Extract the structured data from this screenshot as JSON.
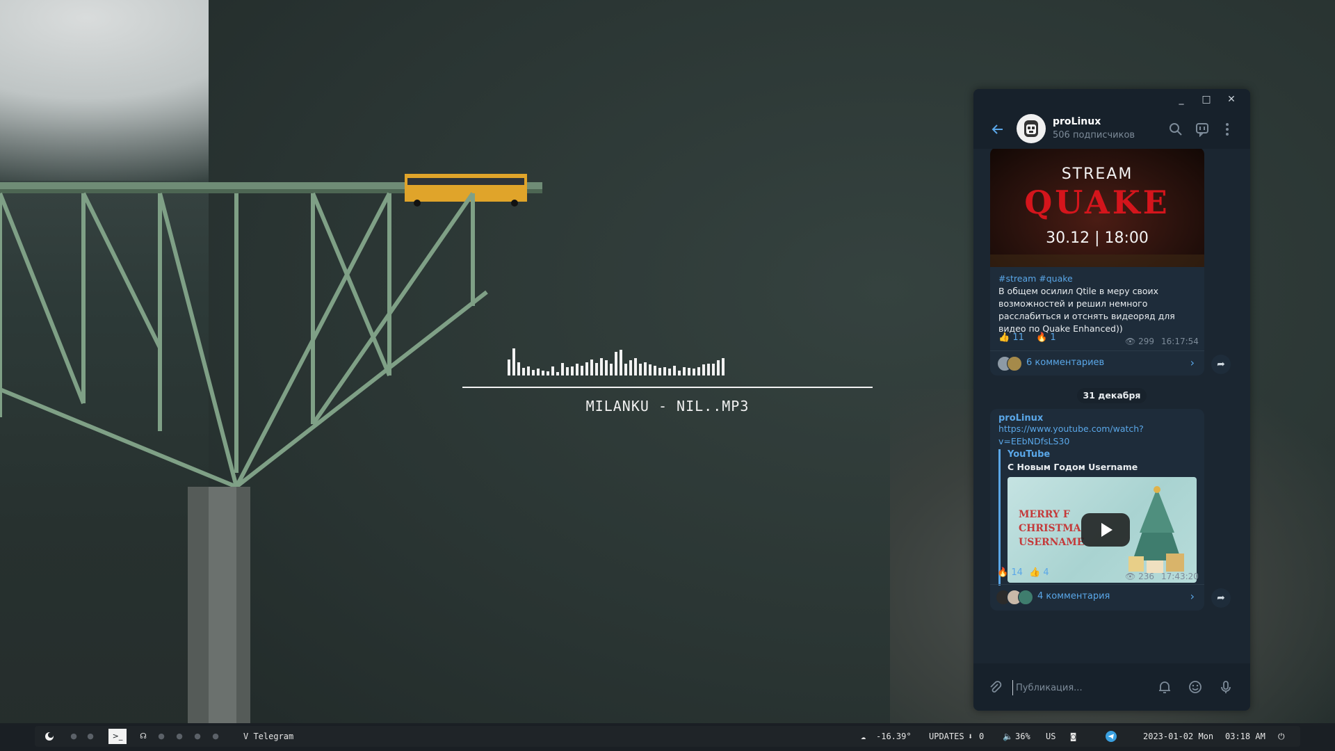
{
  "visualizer": {
    "track": "MILANKU - NIL..MP3",
    "levels": [
      0.38,
      0.65,
      0.32,
      0.18,
      0.22,
      0.14,
      0.16,
      0.12,
      0.1,
      0.22,
      0.08,
      0.3,
      0.2,
      0.22,
      0.28,
      0.24,
      0.32,
      0.38,
      0.3,
      0.42,
      0.36,
      0.28,
      0.56,
      0.62,
      0.28,
      0.36,
      0.42,
      0.28,
      0.32,
      0.26,
      0.24,
      0.18,
      0.2,
      0.16,
      0.24,
      0.12,
      0.2,
      0.18,
      0.16,
      0.2,
      0.26,
      0.28,
      0.28,
      0.36,
      0.42
    ]
  },
  "telegram": {
    "window_controls": {
      "minimize": "_",
      "maximize": "□",
      "close": "✕"
    },
    "channel": {
      "name": "proLinux",
      "subscribers": "506 подписчиков"
    },
    "post1": {
      "sender_cut": "proLinux",
      "image": {
        "line1": "STREAM",
        "line2": "QUAKE",
        "line3": "30.12 | 18:00"
      },
      "tags": "#stream #quake",
      "text": "В общем осилил Qtile в меру своих возможностей и решил немного расслабиться и отснять видеоряд для видео по Quake Enhanced))",
      "reactions": [
        {
          "emoji": "👍",
          "count": "11"
        },
        {
          "emoji": "🔥",
          "count": "1"
        }
      ],
      "views": "299",
      "time": "16:17:54",
      "comments": "6 комментариев"
    },
    "date_divider": "31 декабря",
    "post2": {
      "sender": "proLinux",
      "link": "https://www.youtube.com/watch?v=EEbNDfsLS30",
      "link_line1": "https://www.youtube.com/watch?",
      "link_line2": "v=EEbNDfsLS30",
      "preview_site": "YouTube",
      "preview_title": "С Новым Годом Username",
      "thumb_text": [
        "MERRY F",
        "CHRISTMA",
        "USERNAME"
      ],
      "reactions": [
        {
          "emoji": "🔥",
          "count": "14"
        },
        {
          "emoji": "👍",
          "count": "4"
        }
      ],
      "views": "236",
      "time": "17:43:20",
      "comments": "4 комментария"
    },
    "composer": {
      "placeholder": "Публикация..."
    }
  },
  "statusbar": {
    "workspaces": [
      "●",
      "●",
      "●",
      "●",
      "●",
      "●",
      "●",
      "●",
      "●"
    ],
    "active_workspace_icon": ">_",
    "window_title": "V Telegram",
    "weather": "-16.39°",
    "updates_label": "UPDATES",
    "updates_count": "0",
    "volume": "36%",
    "layout": "US",
    "date": "2023-01-02 Mon",
    "time": "03:18 AM"
  },
  "colors": {
    "accent": "#5aa7e8",
    "window_bg": "#17212b",
    "bubble": "#1e2c3a",
    "bar_bg": "#1a1f24"
  }
}
